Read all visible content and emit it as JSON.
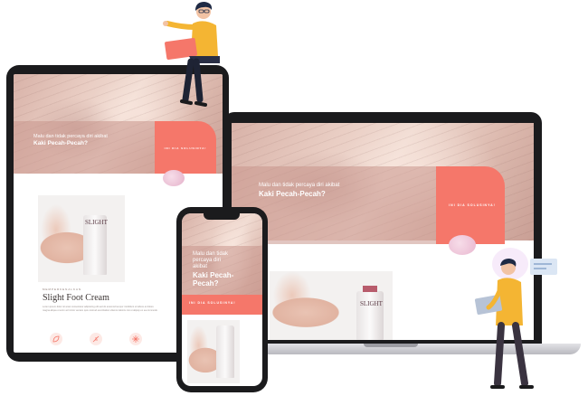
{
  "hero": {
    "line1": "Malu dan tidak percaya diri akibat",
    "headline": "Kaki Pecah-Pecah?",
    "cta": "INI DIA SOLUSINYA!"
  },
  "phone_hero": {
    "line1": "Malu dan tidak",
    "line2": "percaya diri",
    "line3": "akibat",
    "headline1": "Kaki Pecah-",
    "headline2": "Pecah?",
    "cta": "INI DIA SOLUSINYA!"
  },
  "product": {
    "kicker": "MEMPERKENALKAN",
    "name": "Slight Foot Cream",
    "brand": "SLIGHT",
    "description": "Lorem ipsum dolor sit amet consectetur adipiscing elit sed do eiusmod tempor incididunt ut labore et dolore magna aliqua ut enim ad minim veniam quis nostrud exercitation ullamco laboris nisi ut aliquip ex ea commodo."
  },
  "colors": {
    "accent": "#f5776a",
    "device": "#1b1b1d"
  },
  "icons": [
    "leaf-icon",
    "feather-icon",
    "sparkle-icon"
  ]
}
